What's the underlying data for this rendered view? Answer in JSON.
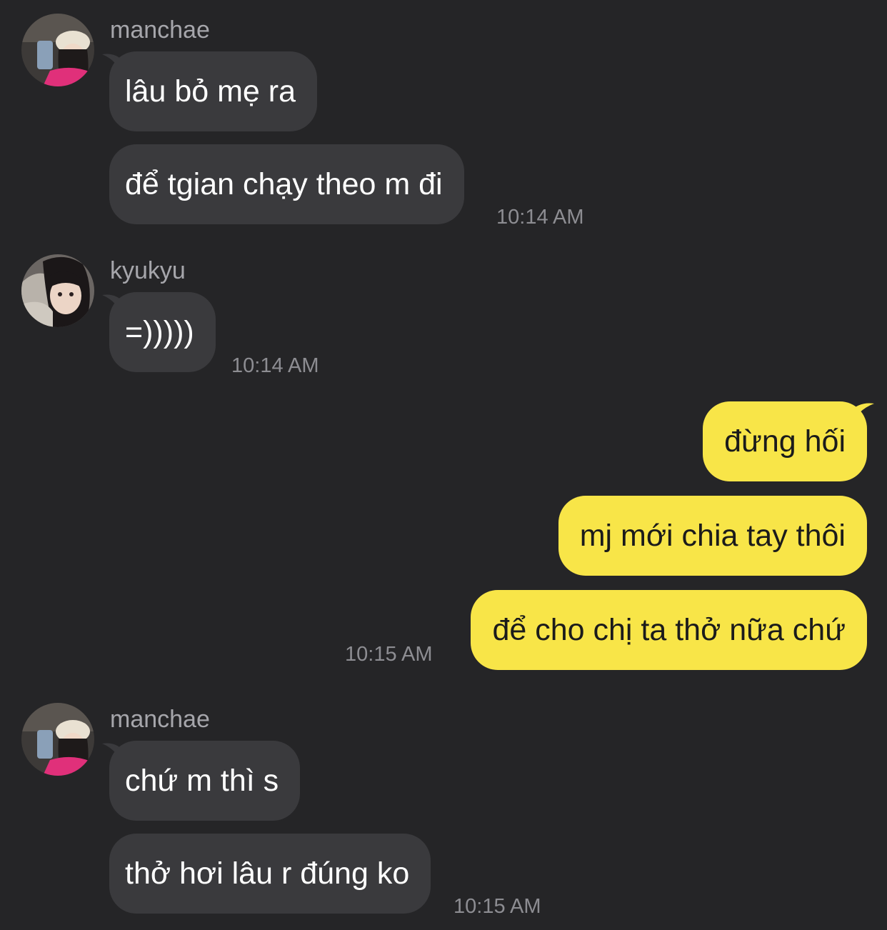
{
  "chat": {
    "groups": [
      {
        "sender": "manchae",
        "avatar": "manchae-avatar",
        "messages": [
          "lâu bỏ mẹ ra",
          "để tgian chạy theo m đi"
        ],
        "time": "10:14 AM"
      },
      {
        "sender": "kyukyu",
        "avatar": "kyukyu-avatar",
        "messages": [
          "=)))))"
        ],
        "time": "10:14 AM"
      },
      {
        "sender": "",
        "outgoing": true,
        "messages": [
          "đừng hối",
          "mj mới chia tay thôi",
          "để cho chị ta thở nữa chứ"
        ],
        "time": "10:15 AM"
      },
      {
        "sender": "manchae",
        "avatar": "manchae-avatar",
        "messages": [
          "chứ m thì s",
          "thở hơi lâu r đúng ko"
        ],
        "time": "10:15 AM"
      }
    ]
  },
  "colors": {
    "background": "#252527",
    "incoming_bubble": "#3a3a3d",
    "outgoing_bubble": "#f8e548",
    "sender_name": "#a6a6ab",
    "timestamp": "#8d8d92"
  }
}
